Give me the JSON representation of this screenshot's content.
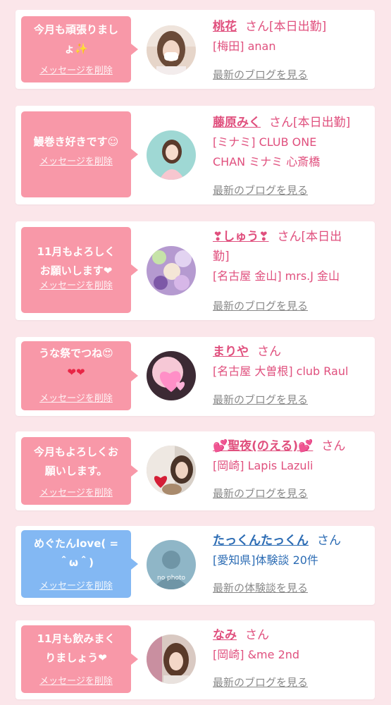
{
  "cards": [
    {
      "message_lines": [
        "今月も頑張りまし",
        "ょ✨"
      ],
      "delete_label": "メッセージを削除",
      "name": "桃花",
      "suffix": "さん[本日出勤]",
      "shop": "[梅田] anan",
      "link": "最新のブログを見る"
    },
    {
      "message_lines": [
        "鰻巻き好きです☺"
      ],
      "delete_label": "メッセージを削除",
      "name": "藤原みく",
      "suffix": "さん[本日出勤]",
      "shop_lines": [
        "[ミナミ] CLUB ONE",
        "CHAN ミナミ 心斎橋"
      ],
      "link": "最新のブログを見る"
    },
    {
      "message_lines": [
        "11月もよろしく",
        "お願いします❤"
      ],
      "delete_label": "メッセージを削除",
      "name": "❣しゅう❣",
      "suffix_lines": [
        "さん[本日出",
        "勤]"
      ],
      "shop": "[名古屋 金山] mrs.J 金山",
      "link": "最新のブログを見る"
    },
    {
      "message_lines": [
        "うな祭でつね😍",
        "❤❤"
      ],
      "delete_label": "メッセージを削除",
      "name": "まりや",
      "suffix": "さん",
      "shop": "[名古屋 大曽根] club Raul",
      "link": "最新のブログを見る"
    },
    {
      "message_lines": [
        "今月もよろしくお",
        "願いします。"
      ],
      "delete_label": "メッセージを削除",
      "name": "💕聖夜(のえる)💕",
      "suffix": "さん",
      "shop": "[岡崎] Lapis Lazuli",
      "link": "最新のブログを見る"
    },
    {
      "message_lines": [
        "めぐたんlove( =",
        "＾ω＾)"
      ],
      "delete_label": "メッセージを削除",
      "name": "たっくんたっくん",
      "suffix": "さん",
      "shop": "[愛知県]体験談 20件",
      "link": "最新の体験談を見る",
      "avatar_text": "no photo"
    },
    {
      "message_lines": [
        "11月も飲みまく",
        "りましょう❤"
      ],
      "delete_label": "メッセージを削除",
      "name": "なみ",
      "suffix": "さん",
      "shop": "[岡崎] &me 2nd",
      "link": "最新のブログを見る"
    }
  ],
  "colors": {
    "page_background": "#fbe6ea",
    "bubble_pink": "#f898a8",
    "bubble_blue": "#83b8f3",
    "name_pink": "#e0507e",
    "name_blue": "#2c6cb4",
    "link_gray": "#8a8a8a"
  },
  "icons": [
    "sparkles-icon",
    "smiling-face-icon",
    "red-heart-icon",
    "heart-eyes-icon",
    "two-hearts-icon"
  ]
}
